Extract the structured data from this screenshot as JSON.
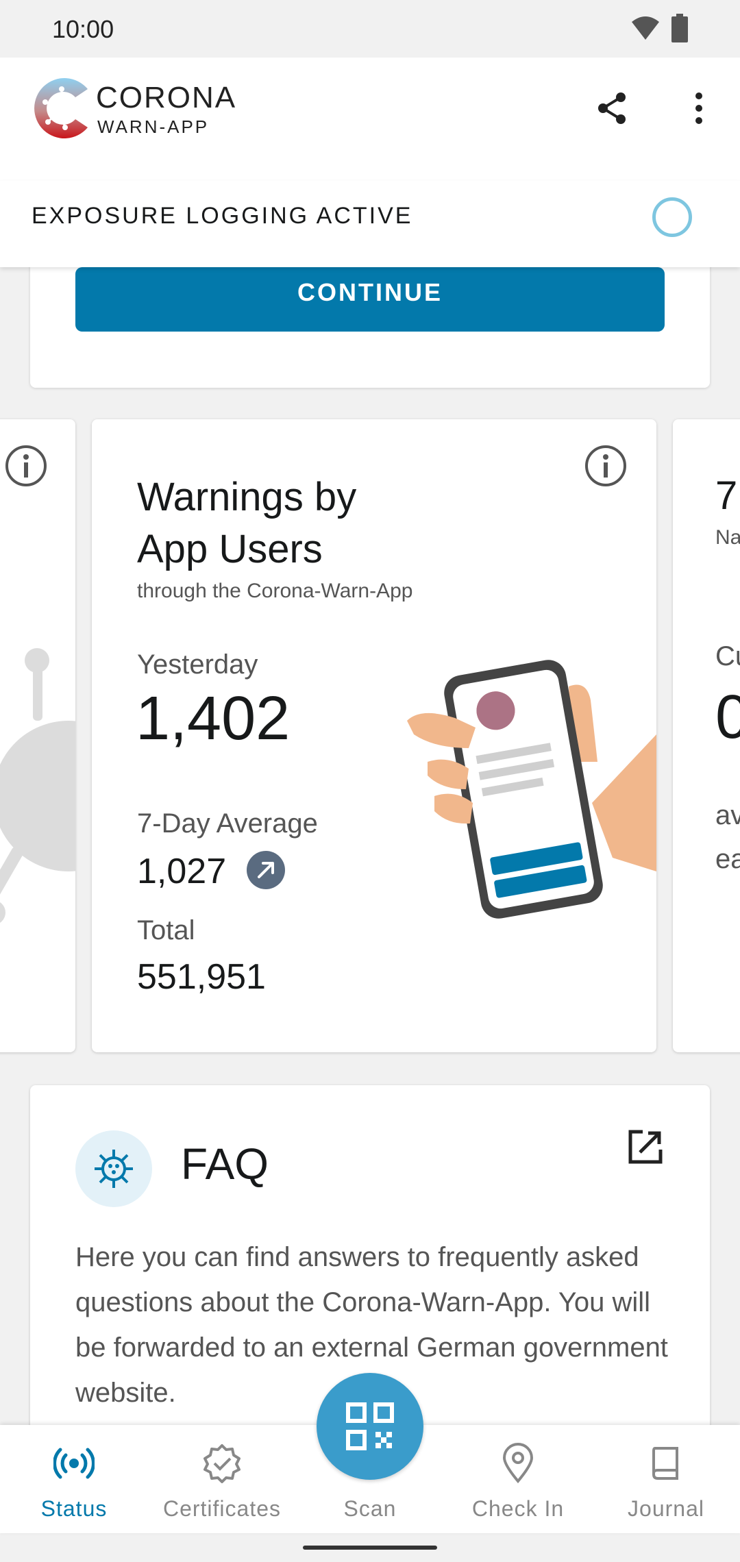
{
  "statusbar": {
    "time": "10:00"
  },
  "header": {
    "brand_line1": "CORONA",
    "brand_line2": "WARN-APP",
    "exposure_label": "EXPOSURE LOGGING ACTIVE"
  },
  "top_card": {
    "continue_label": "CONTINUE"
  },
  "stats_card": {
    "title": "Warnings by App Users",
    "subtitle": "through the Corona-Warn-App",
    "yesterday_label": "Yesterday",
    "yesterday_value": "1,402",
    "avg_label": "7-Day Average",
    "avg_value": "1,027",
    "total_label": "Total",
    "total_value": "551,951"
  },
  "right_card_partial": {
    "line1": "7",
    "line2": "Na",
    "line3": "Cu",
    "line4": "0",
    "line5": "av",
    "line6": "ea"
  },
  "faq": {
    "title": "FAQ",
    "body": "Here you can find answers to frequently asked questions about the Corona-Warn-App. You will be forwarded to an external German government website."
  },
  "nav": {
    "items": [
      {
        "label": "Status",
        "icon": "broadcast-icon",
        "active": true
      },
      {
        "label": "Certificates",
        "icon": "certificate-badge-icon",
        "active": false
      },
      {
        "label": "Scan",
        "icon": "qr-code-icon",
        "active": false
      },
      {
        "label": "Check In",
        "icon": "location-pin-icon",
        "active": false
      },
      {
        "label": "Journal",
        "icon": "book-icon",
        "active": false
      }
    ]
  },
  "colors": {
    "primary": "#0379ab",
    "fab": "#3a9ccb",
    "active_nav": "#0379ab",
    "exposure_ring": "#7ec6e0"
  }
}
